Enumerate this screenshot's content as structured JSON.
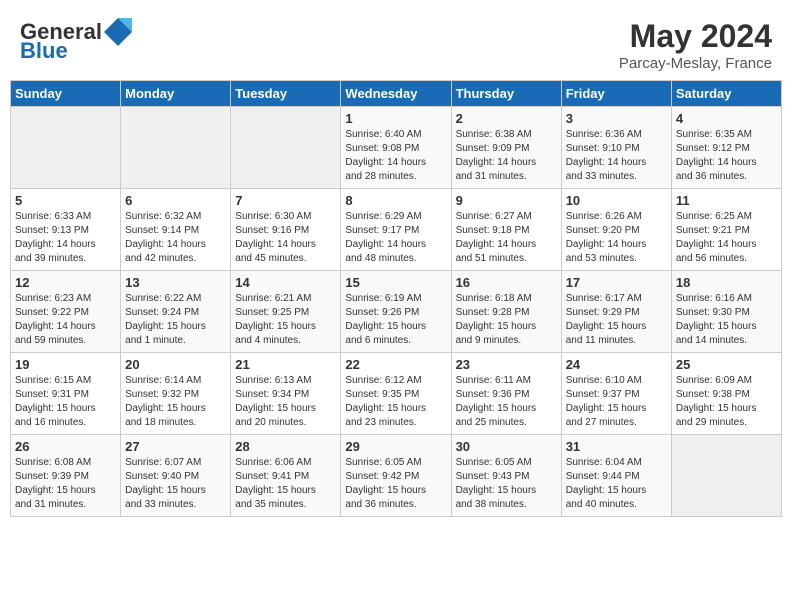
{
  "header": {
    "logo_general": "General",
    "logo_blue": "Blue",
    "month_year": "May 2024",
    "location": "Parcay-Meslay, France"
  },
  "days_of_week": [
    "Sunday",
    "Monday",
    "Tuesday",
    "Wednesday",
    "Thursday",
    "Friday",
    "Saturday"
  ],
  "weeks": [
    [
      {
        "day": "",
        "info": ""
      },
      {
        "day": "",
        "info": ""
      },
      {
        "day": "",
        "info": ""
      },
      {
        "day": "1",
        "info": "Sunrise: 6:40 AM\nSunset: 9:08 PM\nDaylight: 14 hours\nand 28 minutes."
      },
      {
        "day": "2",
        "info": "Sunrise: 6:38 AM\nSunset: 9:09 PM\nDaylight: 14 hours\nand 31 minutes."
      },
      {
        "day": "3",
        "info": "Sunrise: 6:36 AM\nSunset: 9:10 PM\nDaylight: 14 hours\nand 33 minutes."
      },
      {
        "day": "4",
        "info": "Sunrise: 6:35 AM\nSunset: 9:12 PM\nDaylight: 14 hours\nand 36 minutes."
      }
    ],
    [
      {
        "day": "5",
        "info": "Sunrise: 6:33 AM\nSunset: 9:13 PM\nDaylight: 14 hours\nand 39 minutes."
      },
      {
        "day": "6",
        "info": "Sunrise: 6:32 AM\nSunset: 9:14 PM\nDaylight: 14 hours\nand 42 minutes."
      },
      {
        "day": "7",
        "info": "Sunrise: 6:30 AM\nSunset: 9:16 PM\nDaylight: 14 hours\nand 45 minutes."
      },
      {
        "day": "8",
        "info": "Sunrise: 6:29 AM\nSunset: 9:17 PM\nDaylight: 14 hours\nand 48 minutes."
      },
      {
        "day": "9",
        "info": "Sunrise: 6:27 AM\nSunset: 9:18 PM\nDaylight: 14 hours\nand 51 minutes."
      },
      {
        "day": "10",
        "info": "Sunrise: 6:26 AM\nSunset: 9:20 PM\nDaylight: 14 hours\nand 53 minutes."
      },
      {
        "day": "11",
        "info": "Sunrise: 6:25 AM\nSunset: 9:21 PM\nDaylight: 14 hours\nand 56 minutes."
      }
    ],
    [
      {
        "day": "12",
        "info": "Sunrise: 6:23 AM\nSunset: 9:22 PM\nDaylight: 14 hours\nand 59 minutes."
      },
      {
        "day": "13",
        "info": "Sunrise: 6:22 AM\nSunset: 9:24 PM\nDaylight: 15 hours\nand 1 minute."
      },
      {
        "day": "14",
        "info": "Sunrise: 6:21 AM\nSunset: 9:25 PM\nDaylight: 15 hours\nand 4 minutes."
      },
      {
        "day": "15",
        "info": "Sunrise: 6:19 AM\nSunset: 9:26 PM\nDaylight: 15 hours\nand 6 minutes."
      },
      {
        "day": "16",
        "info": "Sunrise: 6:18 AM\nSunset: 9:28 PM\nDaylight: 15 hours\nand 9 minutes."
      },
      {
        "day": "17",
        "info": "Sunrise: 6:17 AM\nSunset: 9:29 PM\nDaylight: 15 hours\nand 11 minutes."
      },
      {
        "day": "18",
        "info": "Sunrise: 6:16 AM\nSunset: 9:30 PM\nDaylight: 15 hours\nand 14 minutes."
      }
    ],
    [
      {
        "day": "19",
        "info": "Sunrise: 6:15 AM\nSunset: 9:31 PM\nDaylight: 15 hours\nand 16 minutes."
      },
      {
        "day": "20",
        "info": "Sunrise: 6:14 AM\nSunset: 9:32 PM\nDaylight: 15 hours\nand 18 minutes."
      },
      {
        "day": "21",
        "info": "Sunrise: 6:13 AM\nSunset: 9:34 PM\nDaylight: 15 hours\nand 20 minutes."
      },
      {
        "day": "22",
        "info": "Sunrise: 6:12 AM\nSunset: 9:35 PM\nDaylight: 15 hours\nand 23 minutes."
      },
      {
        "day": "23",
        "info": "Sunrise: 6:11 AM\nSunset: 9:36 PM\nDaylight: 15 hours\nand 25 minutes."
      },
      {
        "day": "24",
        "info": "Sunrise: 6:10 AM\nSunset: 9:37 PM\nDaylight: 15 hours\nand 27 minutes."
      },
      {
        "day": "25",
        "info": "Sunrise: 6:09 AM\nSunset: 9:38 PM\nDaylight: 15 hours\nand 29 minutes."
      }
    ],
    [
      {
        "day": "26",
        "info": "Sunrise: 6:08 AM\nSunset: 9:39 PM\nDaylight: 15 hours\nand 31 minutes."
      },
      {
        "day": "27",
        "info": "Sunrise: 6:07 AM\nSunset: 9:40 PM\nDaylight: 15 hours\nand 33 minutes."
      },
      {
        "day": "28",
        "info": "Sunrise: 6:06 AM\nSunset: 9:41 PM\nDaylight: 15 hours\nand 35 minutes."
      },
      {
        "day": "29",
        "info": "Sunrise: 6:05 AM\nSunset: 9:42 PM\nDaylight: 15 hours\nand 36 minutes."
      },
      {
        "day": "30",
        "info": "Sunrise: 6:05 AM\nSunset: 9:43 PM\nDaylight: 15 hours\nand 38 minutes."
      },
      {
        "day": "31",
        "info": "Sunrise: 6:04 AM\nSunset: 9:44 PM\nDaylight: 15 hours\nand 40 minutes."
      },
      {
        "day": "",
        "info": ""
      }
    ]
  ]
}
